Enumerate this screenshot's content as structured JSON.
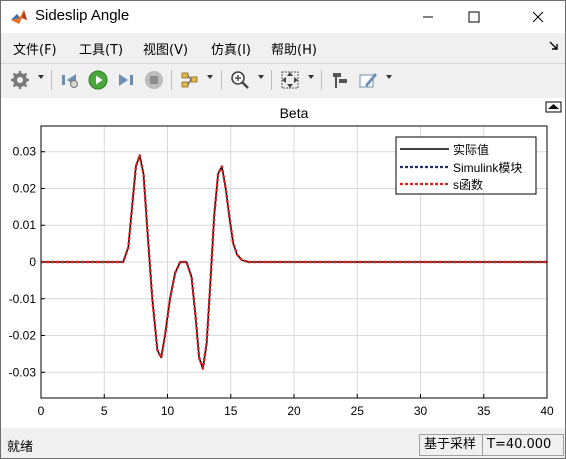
{
  "window": {
    "title": "Sideslip Angle"
  },
  "menu": {
    "items": [
      "文件(F)",
      "工具(T)",
      "视图(V)",
      "仿真(I)",
      "帮助(H)"
    ]
  },
  "toolbar": {
    "icons": [
      "gear-icon",
      "step-back-icon",
      "run-icon",
      "step-forward-icon",
      "stop-icon",
      "signal-selector-icon",
      "zoom-in-icon",
      "fit-to-view-icon",
      "cursor-measure-icon",
      "style-edit-icon"
    ]
  },
  "colors": {
    "actual": "#000000",
    "simulink": "#1f2f6e",
    "sfunc": "#e0201b",
    "title_bg": "#ffffff",
    "plot_bg": "#ffffff"
  },
  "chart_data": {
    "type": "line",
    "title": "Beta",
    "xlabel": "",
    "ylabel": "",
    "xlim": [
      0,
      40
    ],
    "ylim": [
      -0.037,
      0.037
    ],
    "xticks": [
      0,
      5,
      10,
      15,
      20,
      25,
      30,
      35,
      40
    ],
    "yticks": [
      0.03,
      0.02,
      0.01,
      0,
      -0.01,
      -0.02,
      -0.03
    ],
    "ytick_labels": [
      "0.03",
      "0.02",
      "0.01",
      "0",
      "-0.01",
      "-0.02",
      "-0.03"
    ],
    "grid": true,
    "legend_position": "top-right",
    "x": [
      0,
      6.5,
      6.9,
      7.2,
      7.5,
      7.8,
      8.1,
      8.4,
      8.8,
      9.2,
      9.5,
      9.8,
      10.2,
      10.6,
      11.0,
      11.5,
      11.9,
      12.2,
      12.5,
      12.8,
      13.1,
      13.4,
      13.7,
      14.0,
      14.3,
      14.6,
      14.9,
      15.2,
      15.5,
      15.9,
      16.4,
      17.0,
      40
    ],
    "series": [
      {
        "name": "实际值",
        "values": [
          0,
          0,
          0.004,
          0.015,
          0.026,
          0.029,
          0.024,
          0.009,
          -0.01,
          -0.024,
          -0.026,
          -0.02,
          -0.01,
          -0.003,
          0,
          0,
          -0.004,
          -0.014,
          -0.026,
          -0.029,
          -0.022,
          -0.005,
          0.013,
          0.024,
          0.026,
          0.02,
          0.012,
          0.005,
          0.002,
          0.0005,
          0,
          0,
          0
        ]
      },
      {
        "name": "Simulink模块",
        "values": [
          0,
          0,
          0.004,
          0.015,
          0.026,
          0.029,
          0.024,
          0.009,
          -0.01,
          -0.024,
          -0.026,
          -0.02,
          -0.01,
          -0.003,
          0,
          0,
          -0.004,
          -0.014,
          -0.026,
          -0.029,
          -0.022,
          -0.005,
          0.013,
          0.024,
          0.026,
          0.02,
          0.012,
          0.005,
          0.002,
          0.0005,
          0,
          0,
          0
        ]
      },
      {
        "name": "s函数",
        "values": [
          0,
          0,
          0.004,
          0.015,
          0.026,
          0.029,
          0.024,
          0.009,
          -0.01,
          -0.024,
          -0.026,
          -0.02,
          -0.01,
          -0.003,
          0,
          0,
          -0.004,
          -0.014,
          -0.026,
          -0.029,
          -0.022,
          -0.005,
          0.013,
          0.024,
          0.026,
          0.02,
          0.012,
          0.005,
          0.002,
          0.0005,
          0,
          0,
          0
        ]
      }
    ]
  },
  "status": {
    "left": "就绪",
    "sample_mode": "基于采样",
    "time": "T=40.000"
  }
}
